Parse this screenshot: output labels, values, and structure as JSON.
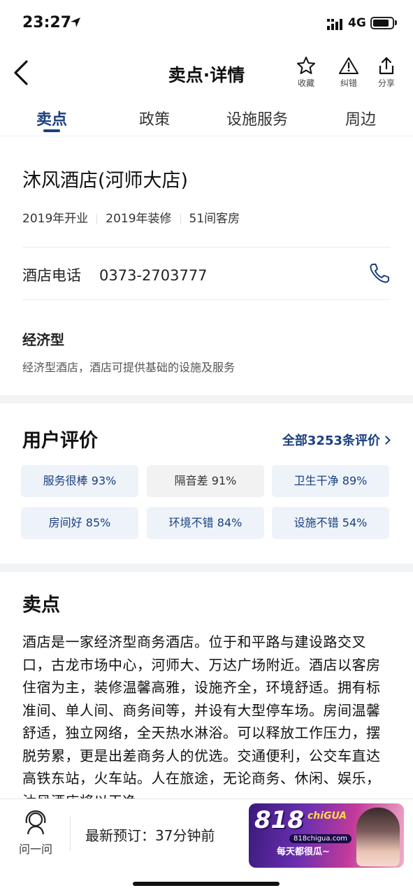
{
  "status_bar": {
    "time": "23:27",
    "network": "4G"
  },
  "header": {
    "title": "卖点·详情",
    "actions": [
      {
        "label": "收藏",
        "icon": "star-icon"
      },
      {
        "label": "纠错",
        "icon": "warning-icon"
      },
      {
        "label": "分享",
        "icon": "share-icon"
      }
    ]
  },
  "tabs": [
    {
      "label": "卖点",
      "active": true
    },
    {
      "label": "政策",
      "active": false
    },
    {
      "label": "设施服务",
      "active": false
    },
    {
      "label": "周边",
      "active": false
    }
  ],
  "hotel": {
    "name": "沐风酒店(河师大店)",
    "opened": "2019年开业",
    "renovated": "2019年装修",
    "rooms": "51间客房",
    "phone_label": "酒店电话",
    "phone": "0373-2703777",
    "type_title": "经济型",
    "type_desc": "经济型酒店，酒店可提供基础的设施及服务"
  },
  "reviews": {
    "title": "用户评价",
    "all_link": "全部3253条评价",
    "tags": [
      {
        "text": "服务很棒 93%",
        "sentiment": "positive"
      },
      {
        "text": "隔音差 91%",
        "sentiment": "negative"
      },
      {
        "text": "卫生干净 89%",
        "sentiment": "positive"
      },
      {
        "text": "房间好 85%",
        "sentiment": "positive"
      },
      {
        "text": "环境不错 84%",
        "sentiment": "positive"
      },
      {
        "text": "设施不错 54%",
        "sentiment": "positive"
      }
    ]
  },
  "selling_points": {
    "title": "卖点",
    "body": "酒店是一家经济型商务酒店。位于和平路与建设路交叉口，古龙市场中心，河师大、万达广场附近。酒店以客房住宿为主，装修温馨高雅，设施齐全，环境舒适。拥有标准间、单人间、商务间等，并设有大型停车场。房间温馨舒适，独立网络，全天热水淋浴。可以释放工作压力，摆脱劳累，更是出差商务人的优选。交通便利，公交车直达高铁东站，火车站。人在旅途，无论商务、休闲、娱乐，沐风酒店将以干净、"
  },
  "bottom_bar": {
    "ask_label": "问一问",
    "latest_booking": "最新预订：37分钟前",
    "promo": {
      "big_text": "818",
      "brand": "chiGUA",
      "url": "818chigua.com",
      "slogan": "每天都很瓜~"
    }
  },
  "colors": {
    "accent": "#1a3f80",
    "tag_positive_bg": "#eef3fa",
    "tag_negative_bg": "#f2f2f2"
  }
}
